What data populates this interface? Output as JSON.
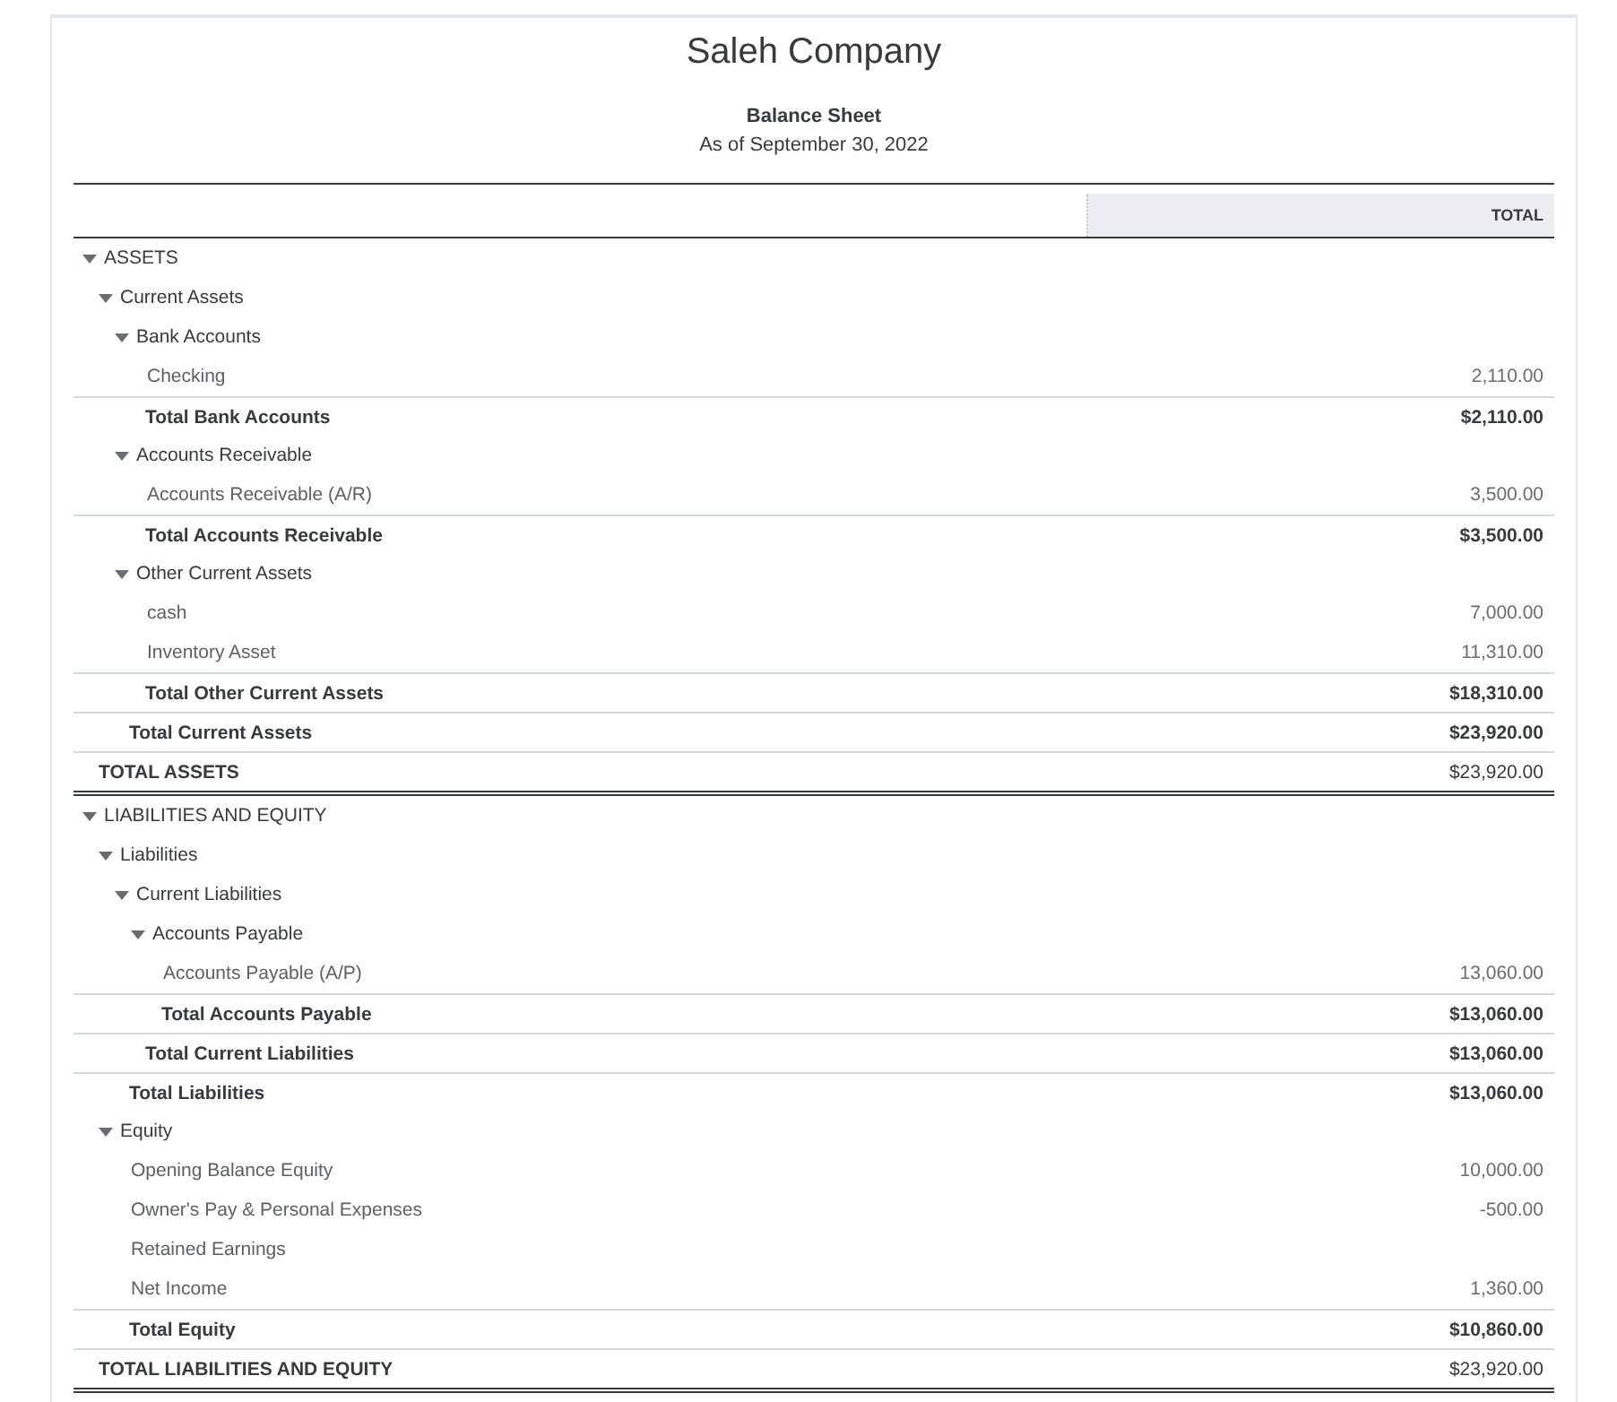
{
  "report": {
    "company": "Saleh Company",
    "title": "Balance Sheet",
    "period": "As of September 30, 2022"
  },
  "columns": [
    "TOTAL"
  ],
  "rows": [
    {
      "kind": "section",
      "label": "ASSETS",
      "expanded": true,
      "children": [
        {
          "kind": "section",
          "label": "Current Assets",
          "expanded": true,
          "children": [
            {
              "kind": "section",
              "label": "Bank Accounts",
              "expanded": true,
              "children": [
                {
                  "kind": "account",
                  "label": "Checking",
                  "amount": "2,110.00"
                }
              ],
              "total": {
                "label": "Total Bank Accounts",
                "amount": "$2,110.00"
              }
            },
            {
              "kind": "section",
              "label": "Accounts Receivable",
              "expanded": true,
              "children": [
                {
                  "kind": "account",
                  "label": "Accounts Receivable (A/R)",
                  "amount": "3,500.00"
                }
              ],
              "total": {
                "label": "Total Accounts Receivable",
                "amount": "$3,500.00"
              }
            },
            {
              "kind": "section",
              "label": "Other Current Assets",
              "expanded": true,
              "children": [
                {
                  "kind": "account",
                  "label": "cash",
                  "amount": "7,000.00"
                },
                {
                  "kind": "account",
                  "label": "Inventory Asset",
                  "amount": "11,310.00"
                }
              ],
              "total": {
                "label": "Total Other Current Assets",
                "amount": "$18,310.00"
              }
            }
          ],
          "total": {
            "label": "Total Current Assets",
            "amount": "$23,920.00"
          }
        }
      ],
      "total": {
        "label": "TOTAL ASSETS",
        "amount": "$23,920.00"
      }
    },
    {
      "kind": "section",
      "label": "LIABILITIES AND EQUITY",
      "expanded": true,
      "children": [
        {
          "kind": "section",
          "label": "Liabilities",
          "expanded": true,
          "children": [
            {
              "kind": "section",
              "label": "Current Liabilities",
              "expanded": true,
              "children": [
                {
                  "kind": "section",
                  "label": "Accounts Payable",
                  "expanded": true,
                  "children": [
                    {
                      "kind": "account",
                      "label": "Accounts Payable (A/P)",
                      "amount": "13,060.00"
                    }
                  ],
                  "total": {
                    "label": "Total Accounts Payable",
                    "amount": "$13,060.00"
                  }
                }
              ],
              "total": {
                "label": "Total Current Liabilities",
                "amount": "$13,060.00"
              }
            }
          ],
          "total": {
            "label": "Total Liabilities",
            "amount": "$13,060.00"
          }
        },
        {
          "kind": "section",
          "label": "Equity",
          "expanded": true,
          "children": [
            {
              "kind": "account",
              "label": "Opening Balance Equity",
              "amount": "10,000.00"
            },
            {
              "kind": "account",
              "label": "Owner's Pay & Personal Expenses",
              "amount": "-500.00"
            },
            {
              "kind": "account",
              "label": "Retained Earnings"
            },
            {
              "kind": "account",
              "label": "Net Income",
              "amount": "1,360.00"
            }
          ],
          "total": {
            "label": "Total Equity",
            "amount": "$10,860.00"
          }
        }
      ],
      "total": {
        "label": "TOTAL LIABILITIES AND EQUITY",
        "amount": "$23,920.00"
      }
    }
  ]
}
